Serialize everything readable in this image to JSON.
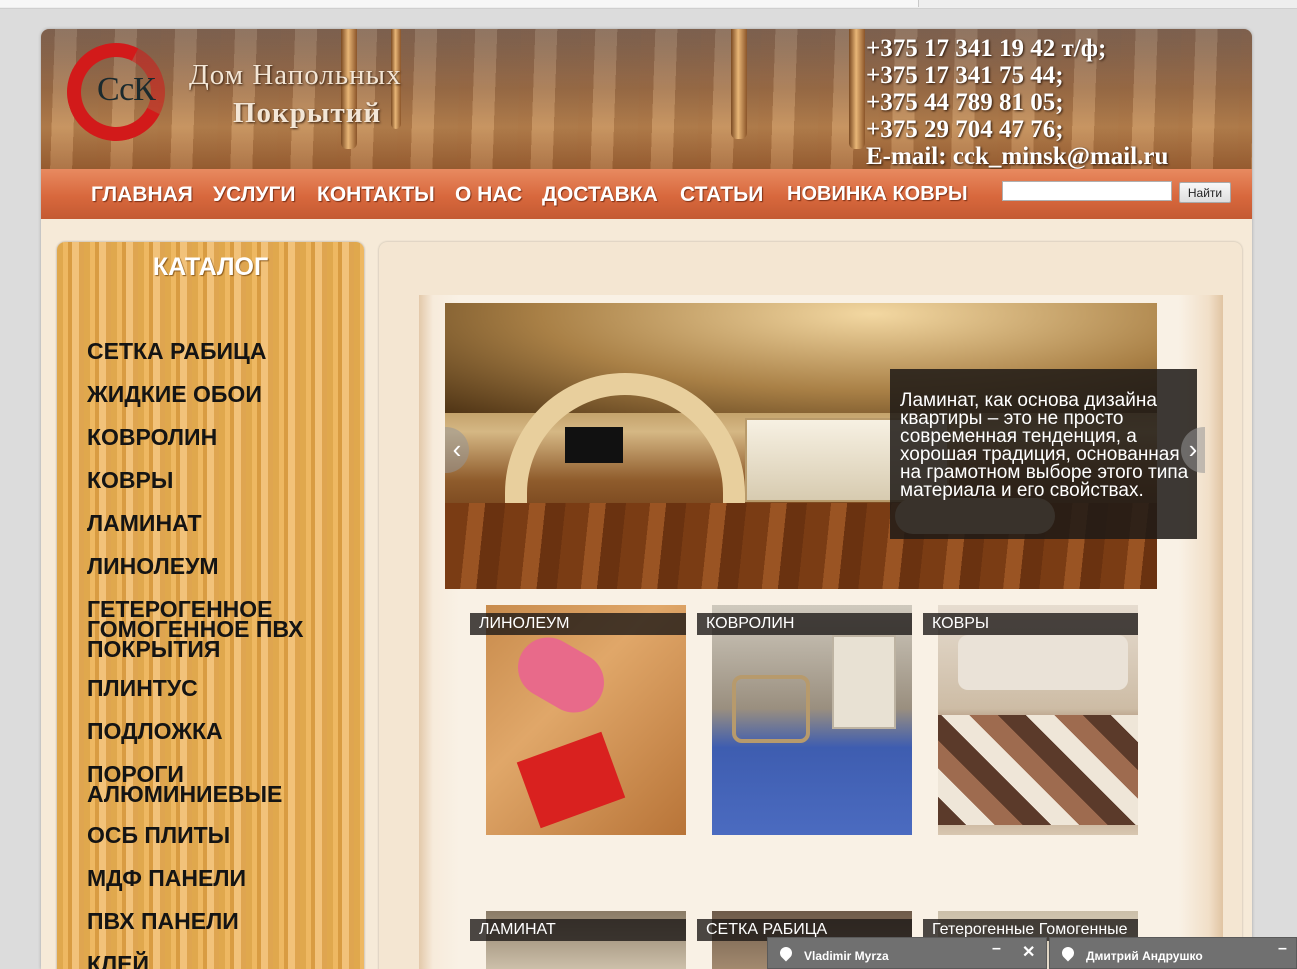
{
  "brand": {
    "logo_mark": "СсК",
    "line1": "Дом Напольных",
    "line2": "Покрытий"
  },
  "contacts": [
    "+375 17 341 19 42 т/ф;",
    "+375 17 341 75 44;",
    "+375 44 789 81 05;",
    "+375 29 704 47 76;",
    "E-mail: cck_minsk@mail.ru"
  ],
  "nav": [
    "ГЛАВНАЯ",
    "УСЛУГИ",
    "КОНТАКТЫ",
    "О НАС",
    "ДОСТАВКА",
    "СТАТЬИ",
    "НОВИНКА КОВРЫ"
  ],
  "search": {
    "value": "",
    "button": "Найти"
  },
  "catalog": {
    "title": "КАТАЛОГ",
    "items": [
      "СЕТКА РАБИЦА",
      "ЖИДКИЕ ОБОИ",
      "КОВРОЛИН",
      "КОВРЫ",
      "ЛАМИНАТ",
      "ЛИНОЛЕУМ",
      "ГЕТЕРОГЕННОЕ ГОМОГЕННОЕ ПВХ ПОКРЫТИЯ",
      "ПЛИНТУС",
      "ПОДЛОЖКА",
      "ПОРОГИ АЛЮМИНИЕВЫЕ",
      "ОСБ ПЛИТЫ",
      "МДФ ПАНЕЛИ",
      "ПВХ ПАНЕЛИ",
      "КЛЕЙ"
    ]
  },
  "slider": {
    "caption": "Ламинат, как основа дизайна квартиры – это не просто современная тенденция, а хорошая традиция, основанная на грамотном выборе этого типа материала и его свойствах.",
    "prev_icon": "‹",
    "next_icon": "›"
  },
  "tiles": [
    "ЛИНОЛЕУМ",
    "КОВРОЛИН",
    "КОВРЫ",
    "ЛАМИНАТ",
    "СЕТКА РАБИЦА",
    "Гетерогенные Гомогенные"
  ],
  "chats": [
    {
      "name": "Vladimir Myrza",
      "min": "–",
      "close": "✕"
    },
    {
      "name": "Дмитрий Андрушко",
      "min": "–"
    }
  ]
}
